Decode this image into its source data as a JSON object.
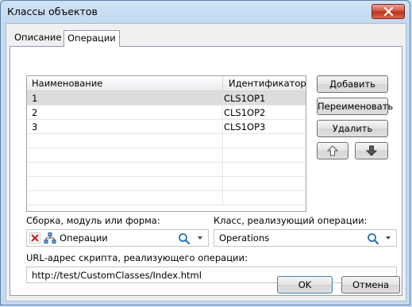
{
  "window": {
    "title": "Классы объектов"
  },
  "tabs": [
    {
      "label": "Описание"
    },
    {
      "label": "Операции"
    }
  ],
  "grid": {
    "columns": [
      "Наименование",
      "Идентификатор"
    ],
    "rows": [
      {
        "name": "1",
        "id": "CLS1OP1"
      },
      {
        "name": "2",
        "id": "CLS1OP2"
      },
      {
        "name": "3",
        "id": "CLS1OP3"
      }
    ]
  },
  "buttons": {
    "add": "Добавить",
    "rename": "Переименовать",
    "delete": "Удалить",
    "ok": "OK",
    "cancel": "Отмена"
  },
  "assembly": {
    "label": "Сборка, модуль или форма:",
    "value": "Операции"
  },
  "class_impl": {
    "label": "Класс, реализующий операции:",
    "value": "Operations"
  },
  "url": {
    "label": "URL-адрес скрипта, реализующего операции:",
    "value": "http://test/CustomClasses/Index.html"
  },
  "colors": {
    "titlebar": "#c4d9ef",
    "close": "#c9442c",
    "selected_row": "#dcdcdc"
  }
}
